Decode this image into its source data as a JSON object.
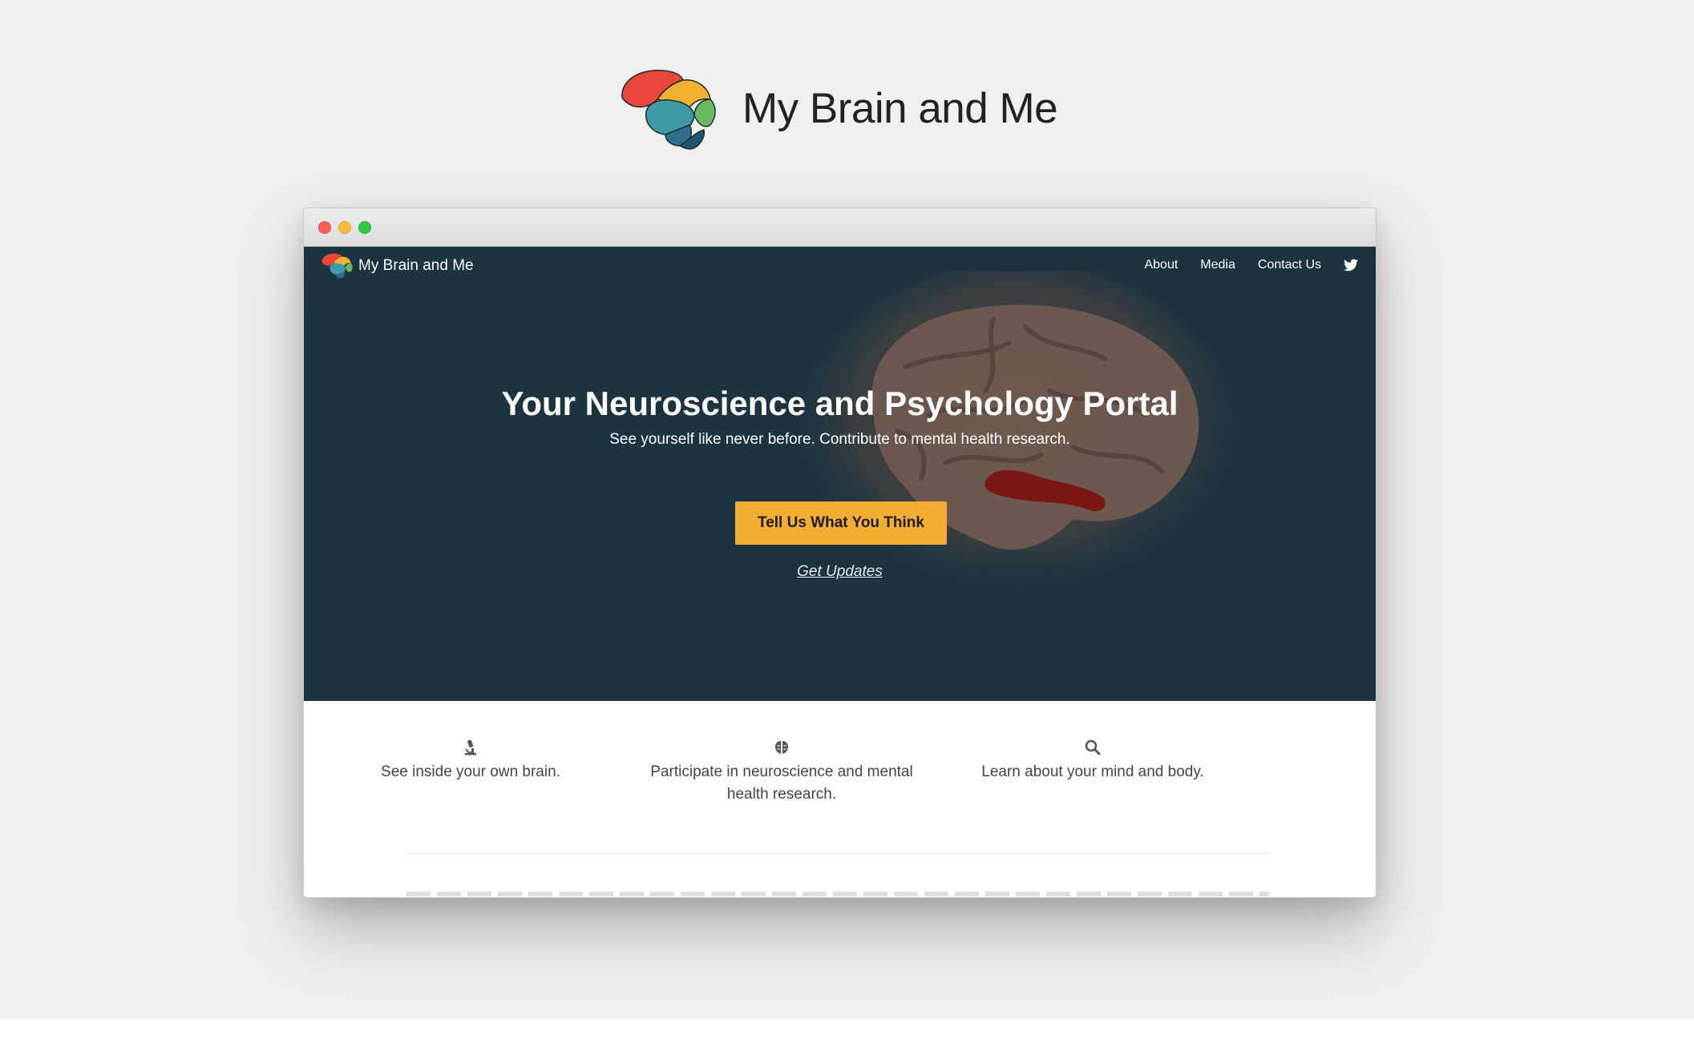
{
  "brand": {
    "title": "My Brain and Me",
    "logo_icon": "brain-logo-icon"
  },
  "browser": {
    "window_controls": [
      "close",
      "minimize",
      "maximize"
    ],
    "navbar": {
      "brand_title": "My Brain and Me",
      "links": [
        "About",
        "Media",
        "Contact Us"
      ],
      "social_icon": "twitter-icon"
    },
    "hero": {
      "title": "Your Neuroscience and Psychology Portal",
      "subtitle": "See yourself like never before. Contribute to mental health research.",
      "cta_label": "Tell Us What You Think",
      "secondary_link": "Get Updates"
    },
    "features": [
      {
        "icon": "microscope-icon",
        "text": "See inside your own brain."
      },
      {
        "icon": "brain-icon",
        "text": "Participate in neuroscience and mental health research."
      },
      {
        "icon": "search-icon",
        "text": "Learn about your mind and body."
      }
    ]
  },
  "colors": {
    "page_background": "#f0f0f0",
    "hero_background": "#1b3440",
    "cta_background": "#f2ad32",
    "text_dark": "#222222"
  }
}
